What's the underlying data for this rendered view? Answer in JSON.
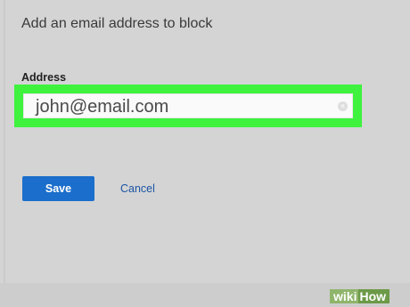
{
  "dialog": {
    "title": "Add an email address to block",
    "address_label": "Address",
    "address_value": "john@email.com",
    "clear_glyph": "×",
    "save_label": "Save",
    "cancel_label": "Cancel"
  },
  "watermark": {
    "wiki": "wiki",
    "how": "How"
  },
  "colors": {
    "highlight": "#3ef23e",
    "save_button": "#1b6ecb",
    "cancel_link": "#1c55a6",
    "background": "#d4d4d4"
  },
  "icons": {
    "clear": "clear-input-icon"
  }
}
